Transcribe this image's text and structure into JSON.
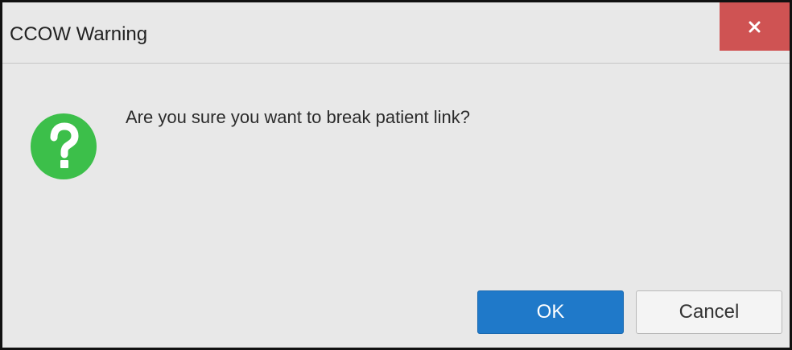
{
  "dialog": {
    "title": "CCOW Warning",
    "close_icon": "close-icon",
    "message": "Are you sure you want to break patient link?",
    "icon": "question-circle-icon"
  },
  "buttons": {
    "ok_label": "OK",
    "cancel_label": "Cancel"
  },
  "colors": {
    "close_button": "#cf5353",
    "ok_button": "#1f79c9",
    "question_icon": "#3cbf4a",
    "dialog_background": "#e8e8e8"
  }
}
